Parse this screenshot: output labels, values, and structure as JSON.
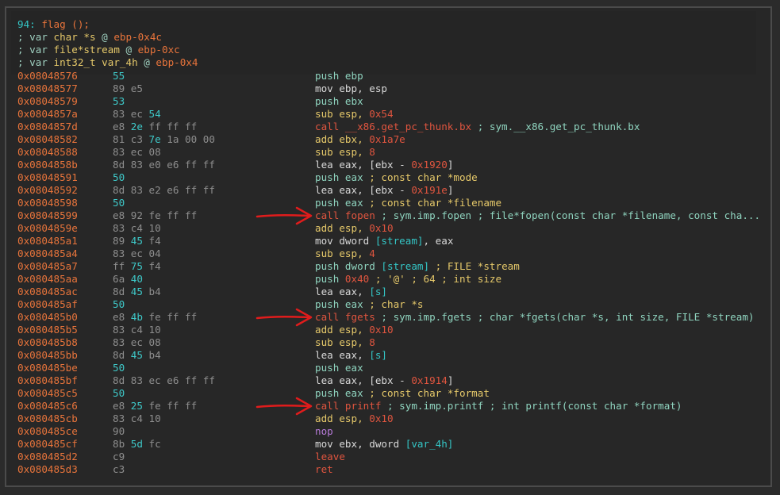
{
  "header": {
    "line1_index": "94:",
    "line1_func": "flag ();",
    "lines": [
      [
        "; var ",
        "char *s",
        " @ ",
        "ebp-0x4c"
      ],
      [
        "; var ",
        "file*stream",
        " @ ",
        "ebp-0xc"
      ],
      [
        "; var ",
        "int32_t var_4h",
        " @ ",
        "ebp-0x4"
      ]
    ]
  },
  "rows": [
    {
      "addr": "0x08048576",
      "bytes": [
        [
          "55",
          "hl"
        ]
      ],
      "asm": [
        [
          "push ebp",
          "green"
        ]
      ]
    },
    {
      "addr": "0x08048577",
      "bytes": [
        [
          "89 e5",
          ""
        ]
      ],
      "asm": [
        [
          "mov ebp, esp",
          "white"
        ]
      ]
    },
    {
      "addr": "0x08048579",
      "bytes": [
        [
          "53",
          "hl"
        ]
      ],
      "asm": [
        [
          "push ebx",
          "green"
        ]
      ]
    },
    {
      "addr": "0x0804857a",
      "bytes": [
        [
          "83 ec ",
          ""
        ],
        [
          "54",
          "hl"
        ]
      ],
      "asm": [
        [
          "sub esp, ",
          "yellow"
        ],
        [
          "0x54",
          "red"
        ]
      ]
    },
    {
      "addr": "0x0804857d",
      "bytes": [
        [
          "e8 ",
          ""
        ],
        [
          "2e",
          "hl"
        ],
        [
          " ff ff ff",
          ""
        ]
      ],
      "asm": [
        [
          "call __x86.get_pc_thunk.bx",
          "red"
        ],
        [
          " ; sym.__x86.get_pc_thunk.bx",
          "green"
        ]
      ]
    },
    {
      "addr": "0x08048582",
      "bytes": [
        [
          "81 c3 ",
          ""
        ],
        [
          "7e",
          "hl"
        ],
        [
          " 1a 00 00",
          ""
        ]
      ],
      "asm": [
        [
          "add ebx, ",
          "yellow"
        ],
        [
          "0x1a7e",
          "red"
        ]
      ]
    },
    {
      "addr": "0x08048588",
      "bytes": [
        [
          "83 ec 08",
          ""
        ]
      ],
      "asm": [
        [
          "sub esp, ",
          "yellow"
        ],
        [
          "8",
          "red"
        ]
      ]
    },
    {
      "addr": "0x0804858b",
      "bytes": [
        [
          "8d 83 e0 e6 ff ff",
          ""
        ]
      ],
      "asm": [
        [
          "lea eax, [ebx - ",
          "white"
        ],
        [
          "0x1920",
          "red"
        ],
        [
          "]",
          "white"
        ]
      ]
    },
    {
      "addr": "0x08048591",
      "bytes": [
        [
          "50",
          "hl"
        ]
      ],
      "asm": [
        [
          "push eax",
          "green"
        ],
        [
          " ; const char *mode",
          "yellow"
        ]
      ]
    },
    {
      "addr": "0x08048592",
      "bytes": [
        [
          "8d 83 e2 e6 ff ff",
          ""
        ]
      ],
      "asm": [
        [
          "lea eax, [ebx - ",
          "white"
        ],
        [
          "0x191e",
          "red"
        ],
        [
          "]",
          "white"
        ]
      ]
    },
    {
      "addr": "0x08048598",
      "bytes": [
        [
          "50",
          "hl"
        ]
      ],
      "asm": [
        [
          "push eax",
          "green"
        ],
        [
          " ; const char *filename",
          "yellow"
        ]
      ]
    },
    {
      "addr": "0x08048599",
      "bytes": [
        [
          "e8 92 fe ff ff",
          ""
        ]
      ],
      "asm": [
        [
          "call fopen",
          "red"
        ],
        [
          " ; sym.imp.fopen ; file*fopen(const char *filename, const cha...",
          "green"
        ]
      ],
      "arrow": true
    },
    {
      "addr": "0x0804859e",
      "bytes": [
        [
          "83 c4 10",
          ""
        ]
      ],
      "asm": [
        [
          "add esp, ",
          "yellow"
        ],
        [
          "0x10",
          "red"
        ]
      ]
    },
    {
      "addr": "0x080485a1",
      "bytes": [
        [
          "89 ",
          ""
        ],
        [
          "45",
          "hl"
        ],
        [
          " f4",
          ""
        ]
      ],
      "asm": [
        [
          "mov dword ",
          "white"
        ],
        [
          "[stream]",
          "cyan"
        ],
        [
          ", eax",
          "white"
        ]
      ]
    },
    {
      "addr": "0x080485a4",
      "bytes": [
        [
          "83 ec 04",
          ""
        ]
      ],
      "asm": [
        [
          "sub esp, ",
          "yellow"
        ],
        [
          "4",
          "red"
        ]
      ]
    },
    {
      "addr": "0x080485a7",
      "bytes": [
        [
          "ff ",
          ""
        ],
        [
          "75",
          "hl"
        ],
        [
          " f4",
          ""
        ]
      ],
      "asm": [
        [
          "push dword ",
          "green"
        ],
        [
          "[stream]",
          "cyan"
        ],
        [
          " ; FILE *stream",
          "yellow"
        ]
      ]
    },
    {
      "addr": "0x080485aa",
      "bytes": [
        [
          "6a ",
          ""
        ],
        [
          "40",
          "hl"
        ]
      ],
      "asm": [
        [
          "push ",
          "green"
        ],
        [
          "0x40",
          "red"
        ],
        [
          " ; '@' ; 64 ; int size",
          "yellow"
        ]
      ]
    },
    {
      "addr": "0x080485ac",
      "bytes": [
        [
          "8d ",
          ""
        ],
        [
          "45",
          "hl"
        ],
        [
          " b4",
          ""
        ]
      ],
      "asm": [
        [
          "lea eax, ",
          "white"
        ],
        [
          "[s]",
          "cyan"
        ]
      ]
    },
    {
      "addr": "0x080485af",
      "bytes": [
        [
          "50",
          "hl"
        ]
      ],
      "asm": [
        [
          "push eax",
          "green"
        ],
        [
          " ; char *s",
          "yellow"
        ]
      ]
    },
    {
      "addr": "0x080485b0",
      "bytes": [
        [
          "e8 ",
          ""
        ],
        [
          "4b",
          "hl"
        ],
        [
          " fe ff ff",
          ""
        ]
      ],
      "asm": [
        [
          "call fgets",
          "red"
        ],
        [
          " ; sym.imp.fgets ; char *fgets(char *s, int size, FILE *stream)",
          "green"
        ]
      ],
      "arrow": true
    },
    {
      "addr": "0x080485b5",
      "bytes": [
        [
          "83 c4 10",
          ""
        ]
      ],
      "asm": [
        [
          "add esp, ",
          "yellow"
        ],
        [
          "0x10",
          "red"
        ]
      ]
    },
    {
      "addr": "0x080485b8",
      "bytes": [
        [
          "83 ec 08",
          ""
        ]
      ],
      "asm": [
        [
          "sub esp, ",
          "yellow"
        ],
        [
          "8",
          "red"
        ]
      ]
    },
    {
      "addr": "0x080485bb",
      "bytes": [
        [
          "8d ",
          ""
        ],
        [
          "45",
          "hl"
        ],
        [
          " b4",
          ""
        ]
      ],
      "asm": [
        [
          "lea eax, ",
          "white"
        ],
        [
          "[s]",
          "cyan"
        ]
      ]
    },
    {
      "addr": "0x080485be",
      "bytes": [
        [
          "50",
          "hl"
        ]
      ],
      "asm": [
        [
          "push eax",
          "green"
        ]
      ]
    },
    {
      "addr": "0x080485bf",
      "bytes": [
        [
          "8d 83 ec e6 ff ff",
          ""
        ]
      ],
      "asm": [
        [
          "lea eax, [ebx - ",
          "white"
        ],
        [
          "0x1914",
          "red"
        ],
        [
          "]",
          "white"
        ]
      ]
    },
    {
      "addr": "0x080485c5",
      "bytes": [
        [
          "50",
          "hl"
        ]
      ],
      "asm": [
        [
          "push eax",
          "green"
        ],
        [
          " ; const char *format",
          "yellow"
        ]
      ]
    },
    {
      "addr": "0x080485c6",
      "bytes": [
        [
          "e8 ",
          ""
        ],
        [
          "25",
          "hl"
        ],
        [
          " fe ff ff",
          ""
        ]
      ],
      "asm": [
        [
          "call printf",
          "red"
        ],
        [
          " ; sym.imp.printf ; int printf(const char *format)",
          "green"
        ]
      ],
      "arrow": true
    },
    {
      "addr": "0x080485cb",
      "bytes": [
        [
          "83 c4 10",
          ""
        ]
      ],
      "asm": [
        [
          "add esp, ",
          "yellow"
        ],
        [
          "0x10",
          "red"
        ]
      ]
    },
    {
      "addr": "0x080485ce",
      "bytes": [
        [
          "90",
          ""
        ]
      ],
      "asm": [
        [
          "nop",
          "purple"
        ]
      ]
    },
    {
      "addr": "0x080485cf",
      "bytes": [
        [
          "8b ",
          ""
        ],
        [
          "5d",
          "hl"
        ],
        [
          " fc",
          ""
        ]
      ],
      "asm": [
        [
          "mov ebx, dword ",
          "white"
        ],
        [
          "[var_4h]",
          "cyan"
        ]
      ]
    },
    {
      "addr": "0x080485d2",
      "bytes": [
        [
          "c9",
          ""
        ]
      ],
      "asm": [
        [
          "leave",
          "red"
        ]
      ]
    },
    {
      "addr": "0x080485d3",
      "bytes": [
        [
          "c3",
          ""
        ]
      ],
      "asm": [
        [
          "ret",
          "red"
        ]
      ]
    }
  ],
  "colors": {
    "background": "#272727",
    "address": "#e8743b",
    "arrow": "#e01c1c"
  },
  "icons": {
    "arrow": "red-right-arrow-icon"
  }
}
